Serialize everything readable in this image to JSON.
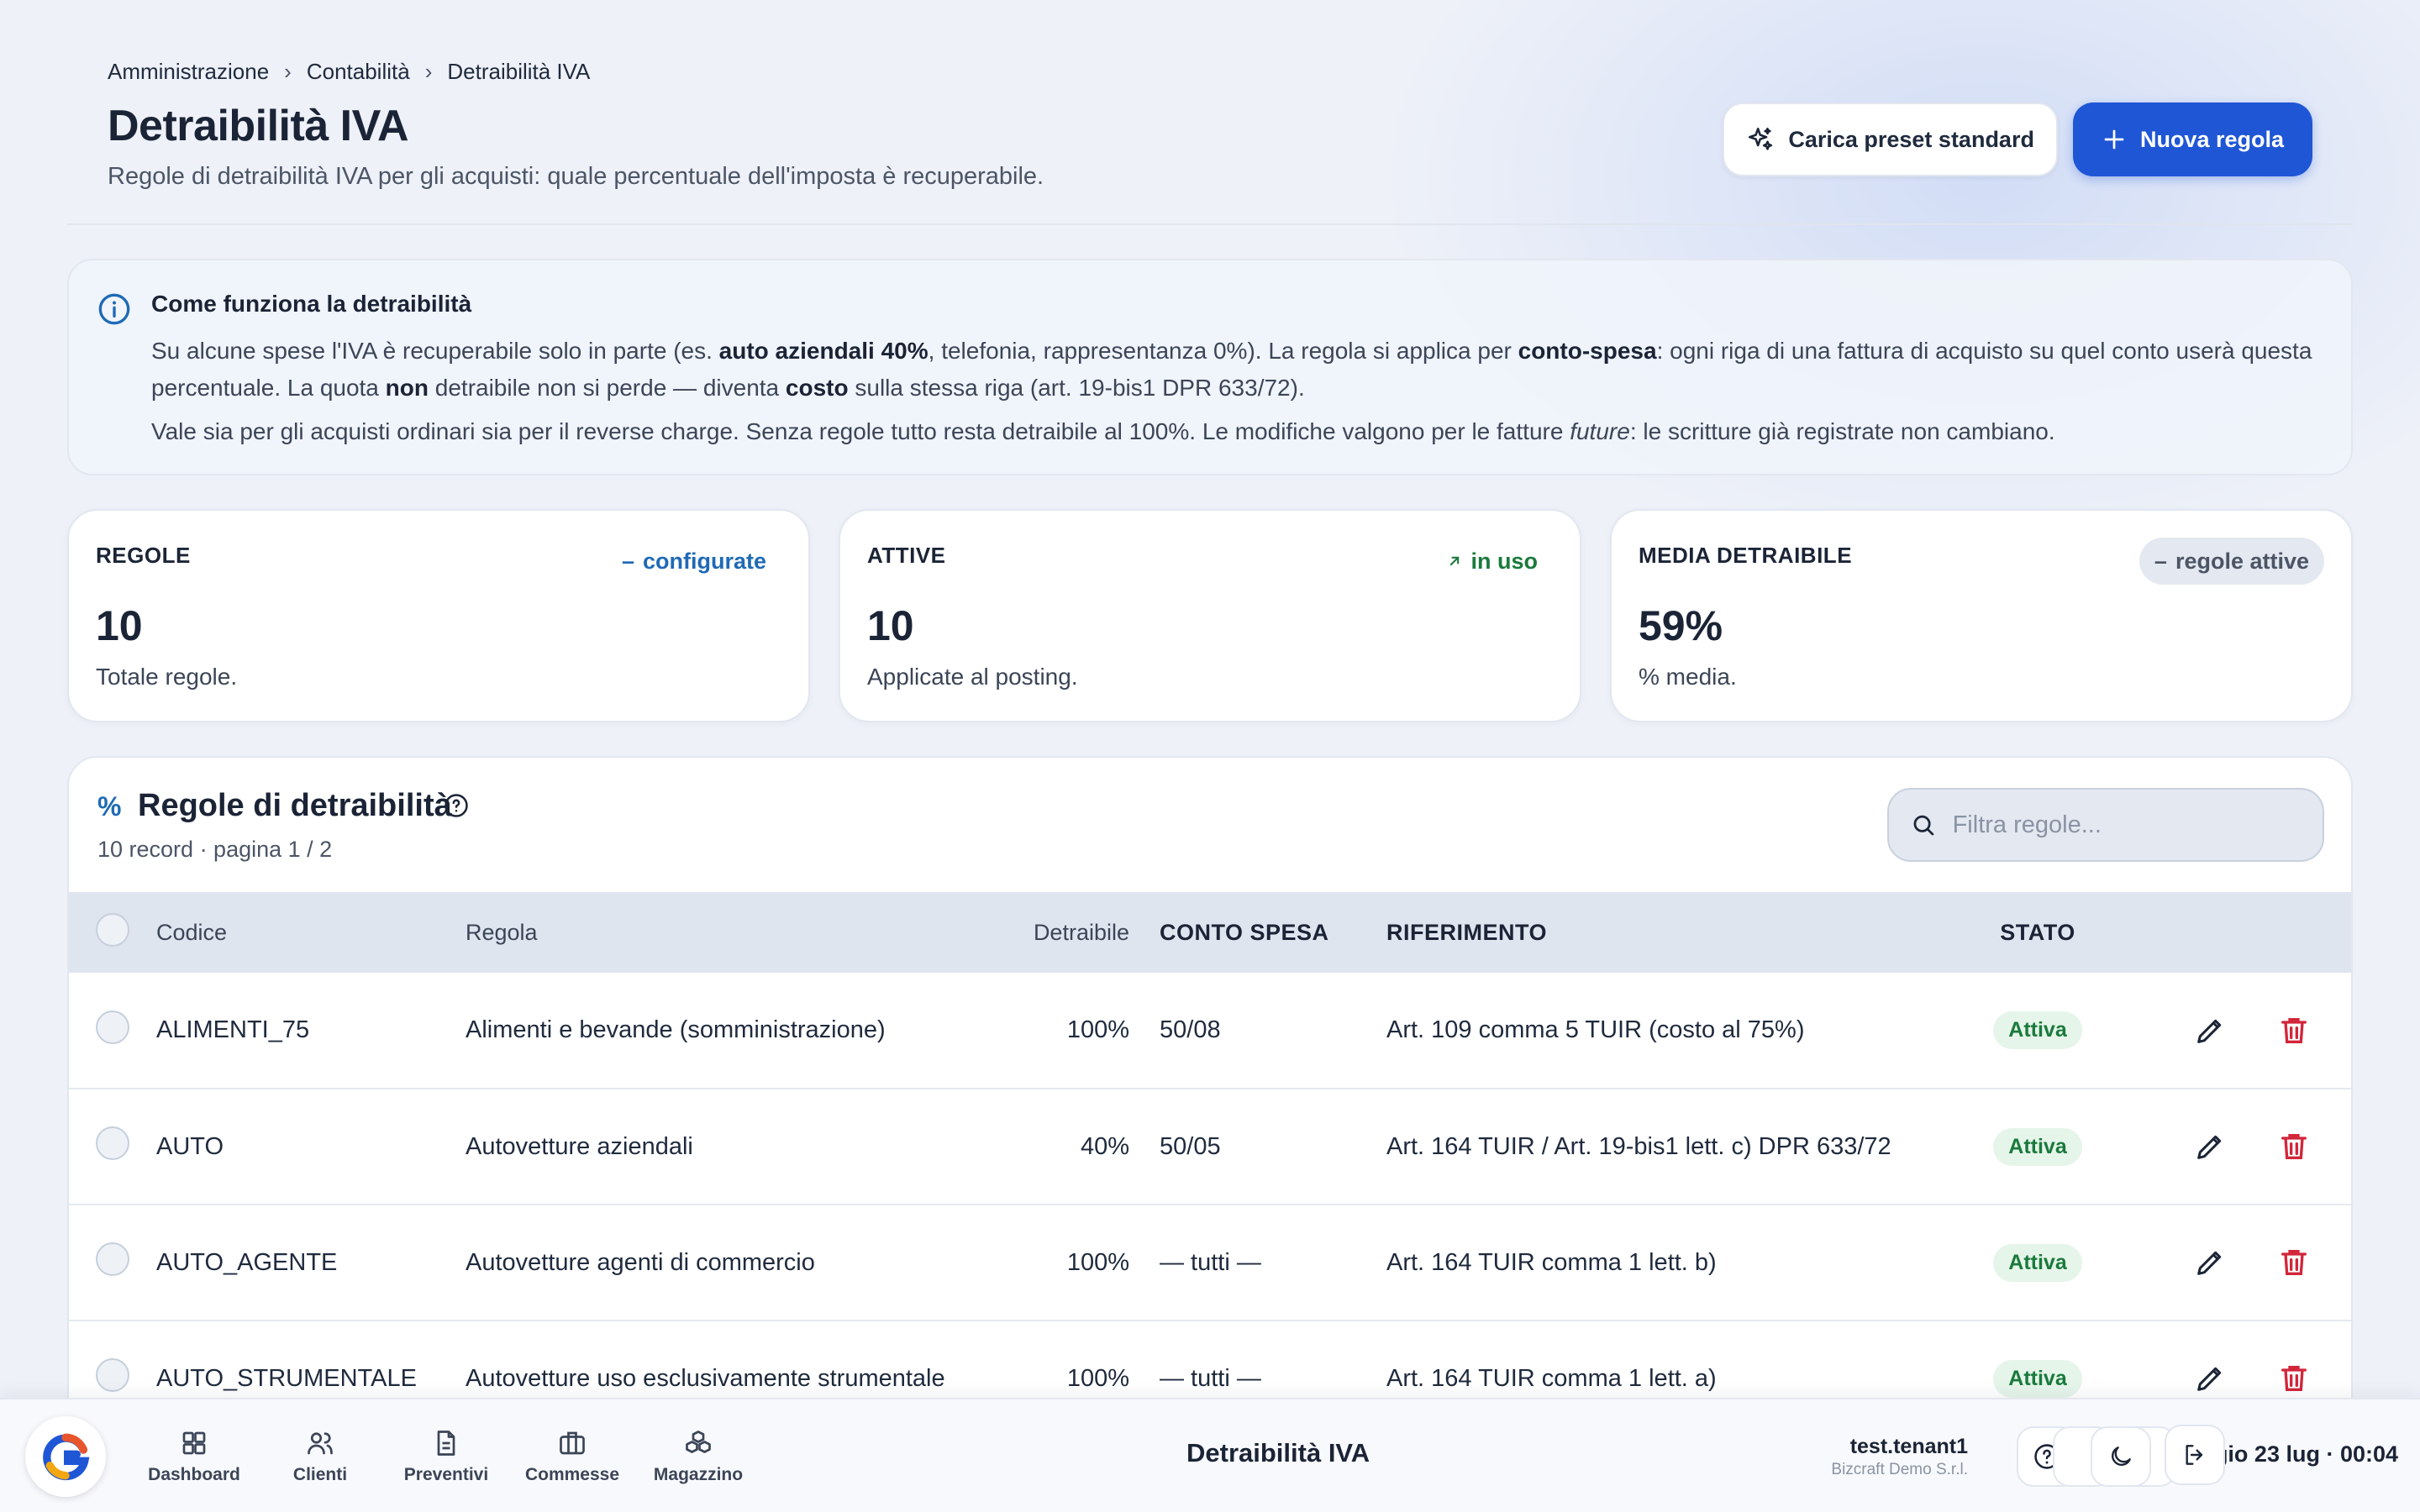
{
  "breadcrumb": [
    "Amministrazione",
    "Contabilità",
    "Detraibilità IVA"
  ],
  "header": {
    "title": "Detraibilità IVA",
    "subtitle": "Regole di detraibilità IVA per gli acquisti: quale percentuale dell'imposta è recuperabile.",
    "preset_label": "Carica preset standard",
    "new_label": "Nuova regola"
  },
  "info": {
    "title": "Come funziona la detraibilità",
    "p1_a": "Su alcune spese l'IVA è recuperabile solo in parte (es. ",
    "p1_b": "auto aziendali 40%",
    "p1_c": ", telefonia, rappresentanza 0%). La regola si applica per ",
    "p1_d": "conto-spesa",
    "p1_e": ": ogni riga di una fattura di acquisto su quel conto userà questa percentuale. La quota ",
    "p1_f": "non",
    "p1_g": " detraibile non si perde — diventa ",
    "p1_h": "costo",
    "p1_i": " sulla stessa riga (art. 19-bis1 DPR 633/72).",
    "p2_a": "Vale sia per gli acquisti ordinari sia per il reverse charge. Senza regole tutto resta detraibile al 100%. Le modifiche valgono per le fatture ",
    "p2_b": "future",
    "p2_c": ": le scritture già registrate non cambiano."
  },
  "stats": [
    {
      "label": "REGOLE",
      "value": "10",
      "desc": "Totale regole.",
      "tag": "configurate",
      "tag_icon": "dash-icon"
    },
    {
      "label": "ATTIVE",
      "value": "10",
      "desc": "Applicate al posting.",
      "tag": "in uso",
      "tag_icon": "arrow-up-right-icon"
    },
    {
      "label": "MEDIA DETRAIBILE",
      "value": "59%",
      "desc": "% media.",
      "tag": "regole attive",
      "tag_icon": "dash-icon"
    }
  ],
  "table": {
    "title": "Regole di detraibilità",
    "subtitle": "10 record · pagina 1 / 2",
    "filter_placeholder": "Filtra regole...",
    "columns": {
      "code": "Codice",
      "rule": "Regola",
      "det": "Detraibile",
      "conto": "CONTO SPESA",
      "rif": "RIFERIMENTO",
      "stato": "STATO"
    },
    "rows": [
      {
        "code": "ALIMENTI_75",
        "rule": "Alimenti e bevande (somministrazione)",
        "det": "100%",
        "conto": "50/08",
        "rif": "Art. 109 comma 5 TUIR (costo al 75%)",
        "stato": "Attiva"
      },
      {
        "code": "AUTO",
        "rule": "Autovetture aziendali",
        "det": "40%",
        "conto": "50/05",
        "rif": "Art. 164 TUIR / Art. 19-bis1 lett. c) DPR 633/72",
        "stato": "Attiva"
      },
      {
        "code": "AUTO_AGENTE",
        "rule": "Autovetture agenti di commercio",
        "det": "100%",
        "conto": "— tutti —",
        "rif": "Art. 164 TUIR comma 1 lett. b)",
        "stato": "Attiva"
      },
      {
        "code": "AUTO_STRUMENTALE",
        "rule": "Autovetture uso esclusivamente strumentale",
        "det": "100%",
        "conto": "— tutti —",
        "rif": "Art. 164 TUIR comma 1 lett. a)",
        "stato": "Attiva"
      }
    ]
  },
  "dock": {
    "nav": [
      {
        "label": "Dashboard",
        "icon": "dashboard-icon"
      },
      {
        "label": "Clienti",
        "icon": "users-icon"
      },
      {
        "label": "Preventivi",
        "icon": "document-icon"
      },
      {
        "label": "Commesse",
        "icon": "briefcase-icon"
      },
      {
        "label": "Magazzino",
        "icon": "boxes-icon"
      }
    ],
    "title": "Detraibilità IVA",
    "user": "test.tenant1",
    "org": "Bizcraft Demo S.r.l.",
    "clock": "gio 23 lug · 00:04"
  },
  "colors": {
    "primary": "#1f56d6",
    "active_badge": "#1a7a3c",
    "delete": "#d2263a"
  }
}
